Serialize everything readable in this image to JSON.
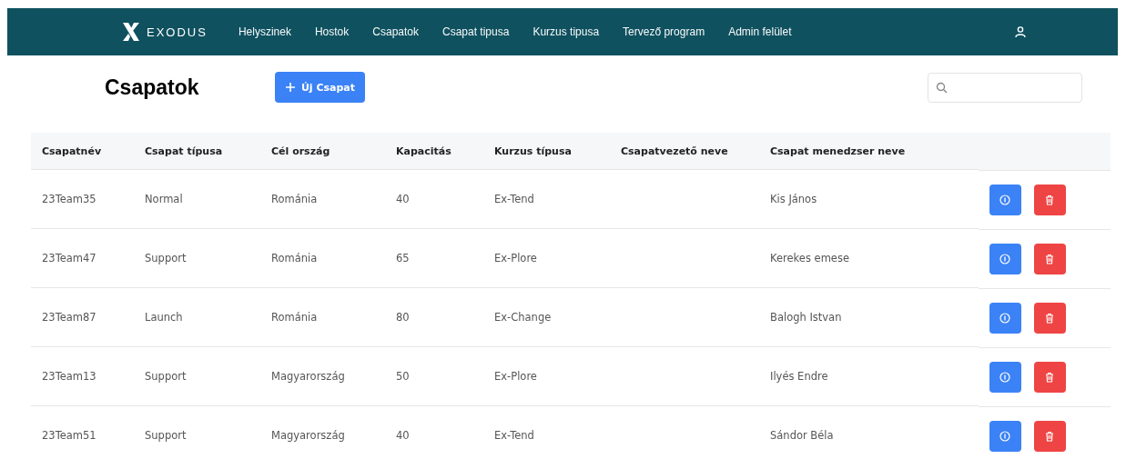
{
  "nav": {
    "logo": "EXODUS",
    "links": [
      "Helyszinek",
      "Hostok",
      "Csapatok",
      "Csapat tipusa",
      "Kurzus tipusa",
      "Tervező program",
      "Admin felület"
    ]
  },
  "page": {
    "title": "Csapatok",
    "new_button": "Új Csapat"
  },
  "table": {
    "columns": [
      "Csapatnév",
      "Csapat típusa",
      "Cél ország",
      "Kapacitás",
      "Kurzus típusa",
      "Csapatvezető neve",
      "Csapat menedzser neve"
    ],
    "rows": [
      [
        "23Team35",
        "Normal",
        "Románia",
        "40",
        "Ex-Tend",
        "",
        "Kis János"
      ],
      [
        "23Team47",
        "Support",
        "Románia",
        "65",
        "Ex-Plore",
        "",
        "Kerekes emese"
      ],
      [
        "23Team87",
        "Launch",
        "Románia",
        "80",
        "Ex-Change",
        "",
        "Balogh Istvan"
      ],
      [
        "23Team13",
        "Support",
        "Magyarország",
        "50",
        "Ex-Plore",
        "",
        "Ilyés Endre"
      ],
      [
        "23Team51",
        "Support",
        "Magyarország",
        "40",
        "Ex-Tend",
        "",
        "Sándor Béla"
      ]
    ]
  }
}
